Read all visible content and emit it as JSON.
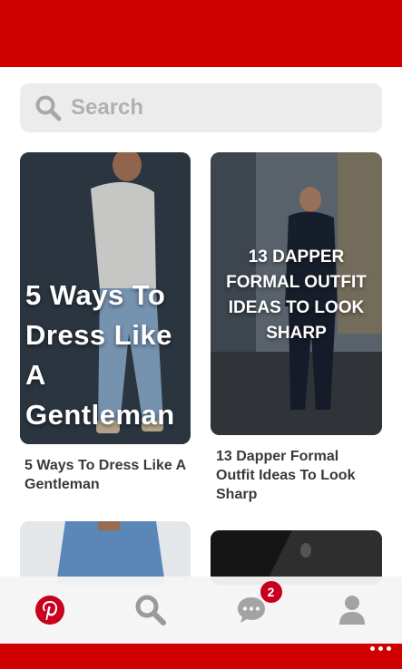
{
  "search": {
    "placeholder": "Search"
  },
  "pins": [
    {
      "overlay_text": "5 Ways To Dress Like A Gentleman",
      "caption": "5 Ways To Dress Like A Gentleman"
    },
    {
      "overlay_text": "13 DAPPER FORMAL OUTFIT IDEAS TO LOOK SHARP",
      "caption": "13 Dapper Formal Outfit Ideas To Look Sharp"
    }
  ],
  "nav": {
    "items": [
      {
        "icon": "pinterest-logo-icon"
      },
      {
        "icon": "search-icon"
      },
      {
        "icon": "messages-icon",
        "badge": "2"
      },
      {
        "icon": "profile-icon"
      }
    ]
  },
  "colors": {
    "brand": "#d10000",
    "badge": "#c8001e"
  }
}
